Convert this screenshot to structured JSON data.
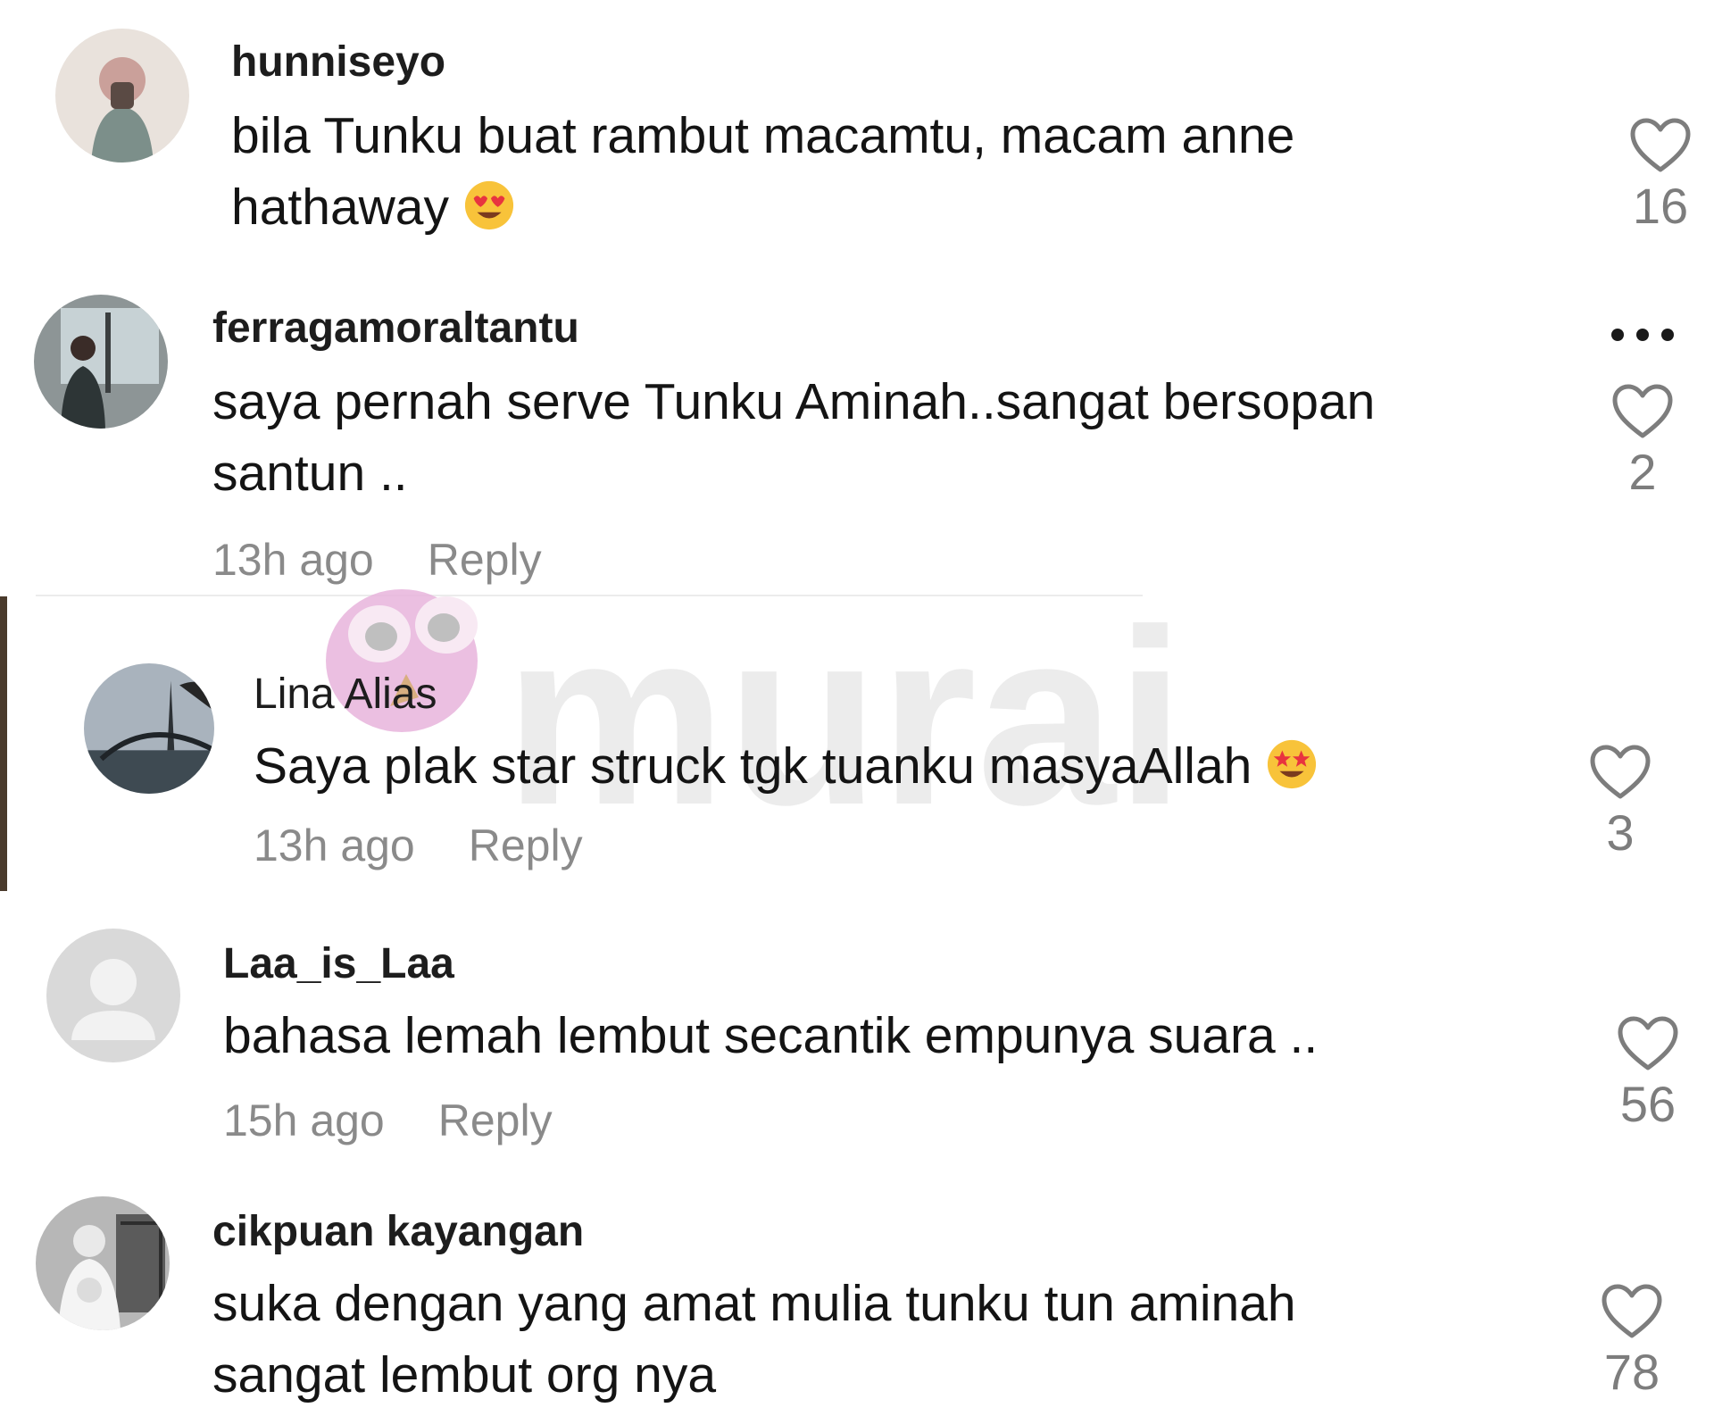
{
  "comments": [
    {
      "username": "hunniseyo",
      "text": "bila Tunku buat rambut macamtu, macam anne hathaway",
      "emoji": "heart-eyes-emoji",
      "likes": "16"
    },
    {
      "username": "ferragamoraltantu",
      "text": "saya pernah serve Tunku Aminah..sangat bersopan santun ..",
      "time": "13h ago",
      "reply_label": "Reply",
      "likes": "2"
    },
    {
      "username": "Lina Alias",
      "text": "Saya plak star struck tgk tuanku masyaAllah",
      "emoji": "star-struck-emoji",
      "time": "13h ago",
      "reply_label": "Reply",
      "likes": "3"
    },
    {
      "username": "Laa_is_Laa",
      "text": "bahasa lemah lembut secantik empunya suara ..",
      "time": "15h ago",
      "reply_label": "Reply",
      "likes": "56"
    },
    {
      "username": "cikpuan kayangan",
      "text": "suka dengan yang amat mulia tunku tun aminah sangat lembut org nya",
      "likes": "78"
    }
  ],
  "watermark": {
    "text": "murai",
    "color": "#e6e6e6",
    "mascot_color": "#e8b4dc"
  },
  "colors": {
    "username": "#1d1d1d",
    "text": "#141414",
    "meta": "#8a8a8a",
    "heart_outline": "#7d7d7d"
  }
}
